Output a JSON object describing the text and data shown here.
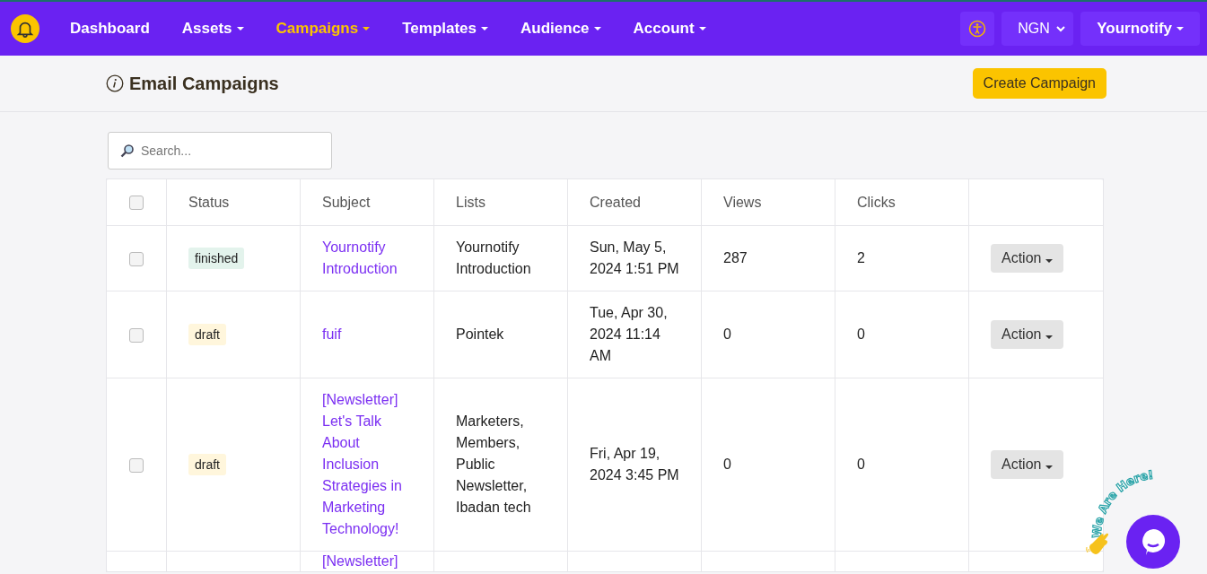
{
  "nav": {
    "items": [
      {
        "label": "Dashboard",
        "dropdown": false,
        "selected": false
      },
      {
        "label": "Assets",
        "dropdown": true,
        "selected": false
      },
      {
        "label": "Campaigns",
        "dropdown": true,
        "selected": true
      },
      {
        "label": "Templates",
        "dropdown": true,
        "selected": false
      },
      {
        "label": "Audience",
        "dropdown": true,
        "selected": false
      },
      {
        "label": "Account",
        "dropdown": true,
        "selected": false
      }
    ],
    "currency": "NGN",
    "user": "Yournotify"
  },
  "page": {
    "title": "Email Campaigns",
    "create_button": "Create Campaign"
  },
  "search": {
    "placeholder": "Search..."
  },
  "table": {
    "columns": [
      "Status",
      "Subject",
      "Lists",
      "Created",
      "Views",
      "Clicks"
    ],
    "header_checked": false,
    "rows": [
      {
        "checked": false,
        "status": "finished",
        "color": "#e3f3ec",
        "subject": "Yournotify Introduction",
        "lists": "Yournotify Introduction",
        "created": "Sun, May 5, 2024 1:51 PM",
        "views": "287",
        "clicks": "2",
        "action": "Action"
      },
      {
        "checked": false,
        "status": "draft",
        "color": "#fff6dc",
        "subject": "fuif",
        "lists": "Pointek",
        "created": "Tue, Apr 30, 2024 11:14 AM",
        "views": "0",
        "clicks": "0",
        "action": "Action"
      },
      {
        "checked": false,
        "status": "draft",
        "color": "#fff6dc",
        "subject": "[Newsletter] Let's Talk About Inclusion Strategies in Marketing Technology!",
        "lists": "Marketers, Members, Public Newsletter, Ibadan tech",
        "created": "Fri, Apr 19, 2024 3:45 PM",
        "views": "0",
        "clicks": "0",
        "action": "Action"
      }
    ],
    "cut_off_row": {
      "subject": "[Newsletter]"
    }
  },
  "chat_widget": {
    "label": "We Are Here!"
  }
}
